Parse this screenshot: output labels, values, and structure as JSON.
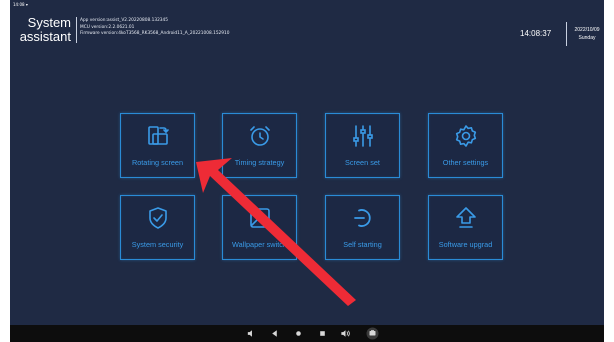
{
  "statusbar": {
    "time": "14:08"
  },
  "header": {
    "app_title_line1": "System",
    "app_title_line2": "assistant",
    "app_version": "App version:assist_V2.20220808.132345",
    "mcu_version": "MCU version:2.2.0621.01",
    "firmware_version": "Firmware version:4koT3568_RK3568_Android11_A_20221008.152910",
    "clock": "14:08:37",
    "date": "2022/10/09",
    "weekday": "Sunday"
  },
  "tiles": [
    {
      "label": "Rotating screen",
      "icon": "rotate-screen-icon"
    },
    {
      "label": "Timing strategy",
      "icon": "alarm-clock-icon"
    },
    {
      "label": "Screen set",
      "icon": "sliders-icon"
    },
    {
      "label": "Other settings",
      "icon": "gear-icon"
    },
    {
      "label": "System security",
      "icon": "shield-check-icon"
    },
    {
      "label": "Wallpaper switch",
      "icon": "wallpaper-icon"
    },
    {
      "label": "Self starting",
      "icon": "power-icon"
    },
    {
      "label": "Software upgrad",
      "icon": "upload-arrow-icon"
    }
  ],
  "navbar": {
    "buttons": [
      "volume-down-icon",
      "back-icon",
      "home-icon",
      "recents-icon",
      "volume-up-icon",
      "screenshot-icon"
    ]
  },
  "colors": {
    "background": "#1f2a44",
    "accent": "#2a8bd6",
    "tile_text": "#3a9be8",
    "annotation_arrow": "#ee2b36"
  }
}
